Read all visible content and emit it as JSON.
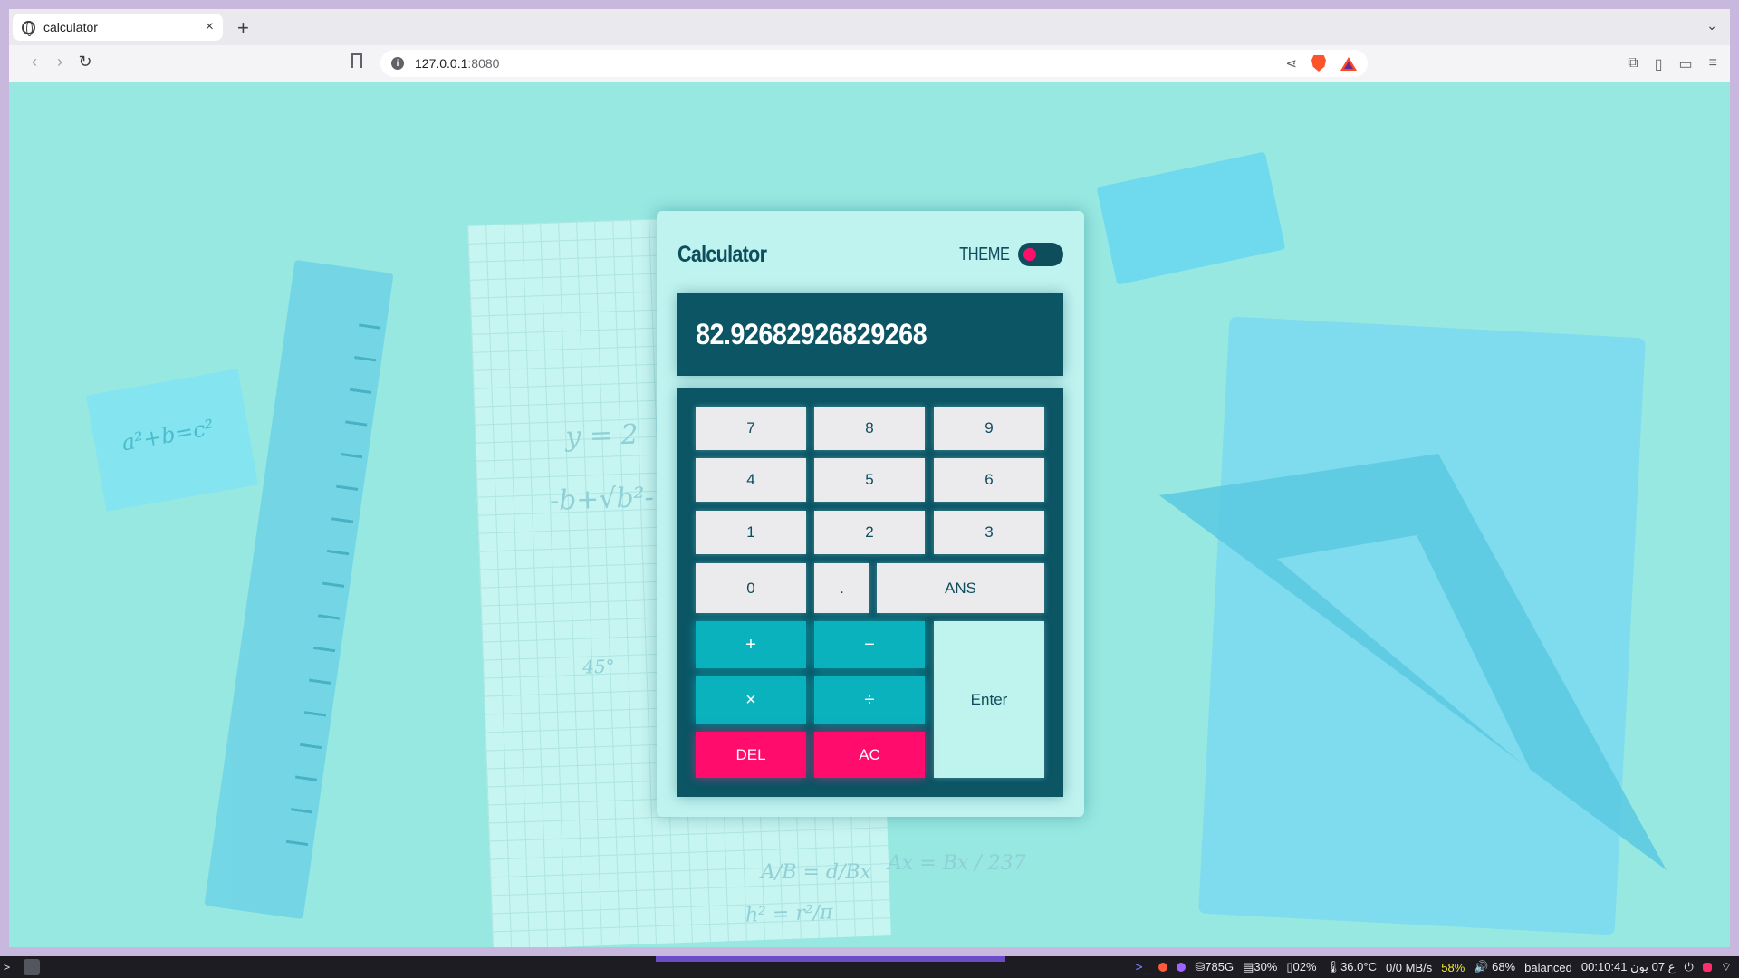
{
  "browser": {
    "tab_title": "calculator",
    "tab_close": "×",
    "new_tab": "+",
    "tab_menu": "⌄",
    "url_host": "127.0.0.1",
    "url_port": ":8080"
  },
  "calculator": {
    "title": "Calculator",
    "theme_label": "THEME",
    "display_value": "82.92682926829268",
    "keys": {
      "k7": "7",
      "k8": "8",
      "k9": "9",
      "k4": "4",
      "k5": "5",
      "k6": "6",
      "k1": "1",
      "k2": "2",
      "k3": "3",
      "k0": "0",
      "dot": ".",
      "ans": "ANS",
      "plus": "+",
      "minus": "−",
      "times": "×",
      "divide": "÷",
      "del": "DEL",
      "ac": "AC",
      "enter": "Enter"
    },
    "colors": {
      "panel": "#bff3f0",
      "display": "#0b5565",
      "operator": "#0ab2bd",
      "danger": "#ff0c6d",
      "page_bg": "#96e8e1"
    }
  },
  "taskbar": {
    "disk": "⛁785G",
    "ram": "▤30%",
    "swap": "▯02%",
    "temp": "🌡36.0°C",
    "net": "0/0 MB/s",
    "battery": "58%",
    "volume": "🔊 68%",
    "power_mode": "balanced",
    "clock": "00:10:41 ع 07 يون"
  },
  "background": {
    "sticky_text": "a²+b=c²",
    "math_1": "y = 2",
    "math_2": "-b+√b²-",
    "math_3": "45°",
    "math_4": "h² = r²/π",
    "math_5": "A/B = d/Bx",
    "math_6": "Ax = Bx / 237"
  }
}
